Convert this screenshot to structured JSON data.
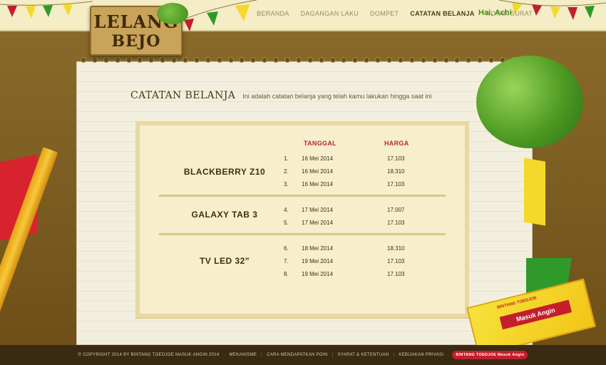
{
  "logo": {
    "line1": "LELANG",
    "line2": "BEJO"
  },
  "nav": {
    "items": [
      {
        "label": "BERANDA",
        "active": false
      },
      {
        "label": "DAGANGAN LAKU",
        "active": false
      },
      {
        "label": "DOMPET",
        "active": false
      },
      {
        "label": "CATATAN BELANJA",
        "active": true
      },
      {
        "label": "KOTAK SURAT",
        "active": false
      }
    ],
    "greeting": "Hai, Achi"
  },
  "section": {
    "title": "CATATAN BELANJA",
    "subtitle": "Ini adalah catatan belanja yang telah kamu lakukan hingga saat ini"
  },
  "table": {
    "col_date": "TANGGAL",
    "col_price": "HARGA",
    "groups": [
      {
        "name": "BLACKBERRY Z10",
        "rows": [
          {
            "num": "1.",
            "date": "16 Mei 2014",
            "price": "17.103"
          },
          {
            "num": "2.",
            "date": "16 Mei 2014",
            "price": "18.310"
          },
          {
            "num": "3.",
            "date": "16 Mei 2014",
            "price": "17.103"
          }
        ]
      },
      {
        "name": "GALAXY TAB 3",
        "rows": [
          {
            "num": "4.",
            "date": "17 Mei 2014",
            "price": "17.007"
          },
          {
            "num": "5.",
            "date": "17 Mei 2014",
            "price": "17.103"
          }
        ]
      },
      {
        "name": "TV LED 32\"",
        "rows": [
          {
            "num": "6.",
            "date": "18 Mei 2014",
            "price": "18.310"
          },
          {
            "num": "7.",
            "date": "19 Mei 2014",
            "price": "17.103"
          },
          {
            "num": "8.",
            "date": "19 Mei 2014",
            "price": "17.103"
          }
        ]
      }
    ]
  },
  "product": {
    "brand": "BINTANG TOEDJOE",
    "name": "Masuk Angin"
  },
  "footer": {
    "copyright": "© COPYRIGHT 2014 BY BINTANG TOEDJOE MASUK ANGIN 2014",
    "links": [
      "MEKANISME",
      "CARA MENDAPATKAN POIN",
      "SYARAT & KETENTUAN",
      "KEBIJAKAN PRIVASI"
    ],
    "badge": "BINTANG TOEDJOE Masuk Angin"
  },
  "colors": {
    "accent_red": "#c0243a",
    "greeting_green": "#4a8e1c"
  }
}
